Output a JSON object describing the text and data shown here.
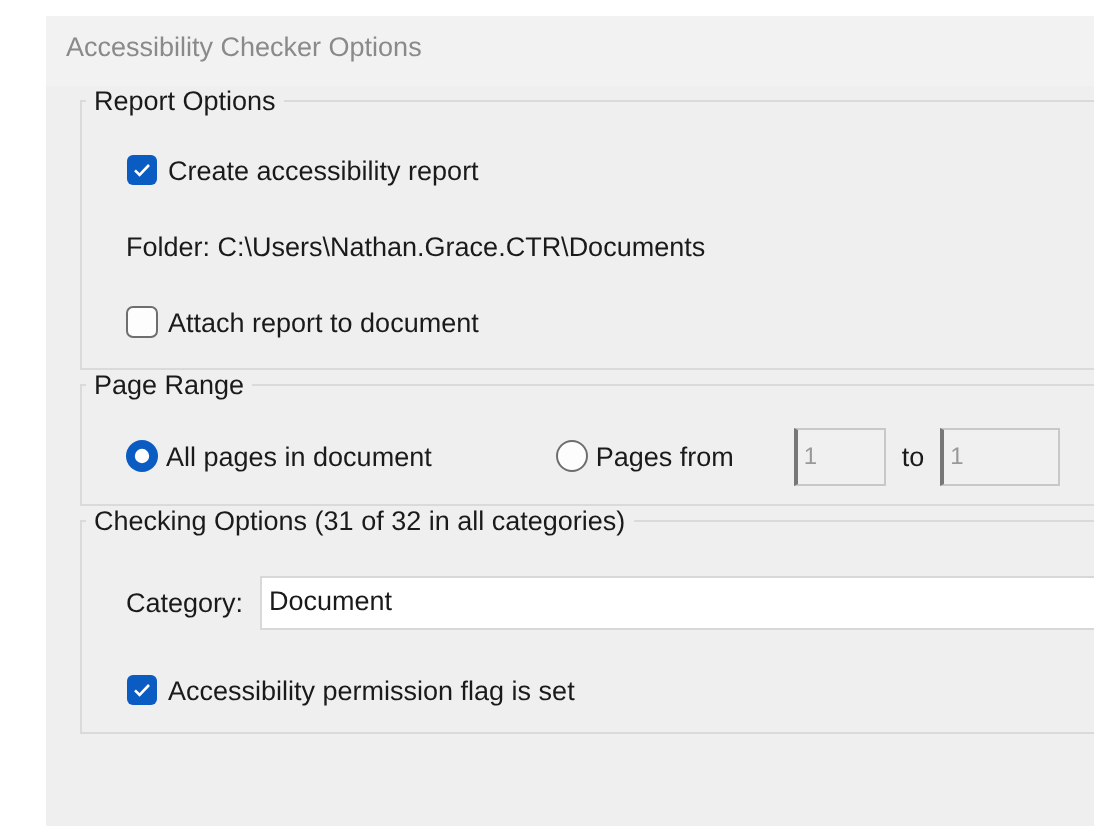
{
  "window": {
    "title": "Accessibility Checker Options"
  },
  "report_options": {
    "title": "Report Options",
    "items": [
      {
        "kind": "checkbox",
        "label": "Create accessibility report",
        "checked": true
      },
      {
        "kind": "text",
        "label": "Folder: C:\\Users\\Nathan.Grace.CTR\\Documents"
      },
      {
        "kind": "checkbox",
        "label": "Attach report to document",
        "checked": false
      }
    ]
  },
  "page_range": {
    "title": "Page Range",
    "options": [
      {
        "label": "All pages in document",
        "selected": true
      },
      {
        "label": "Pages from",
        "selected": false
      }
    ],
    "from": {
      "value": "1",
      "disabled": true
    },
    "to_label": "to",
    "to": {
      "value": "1",
      "disabled": true
    }
  },
  "checking_options": {
    "title": "Checking Options (31 of 32 in all categories)",
    "category_label": "Category:",
    "category": "Document",
    "rules": [
      {
        "label": "Accessibility permission flag is set",
        "checked": true
      }
    ]
  }
}
